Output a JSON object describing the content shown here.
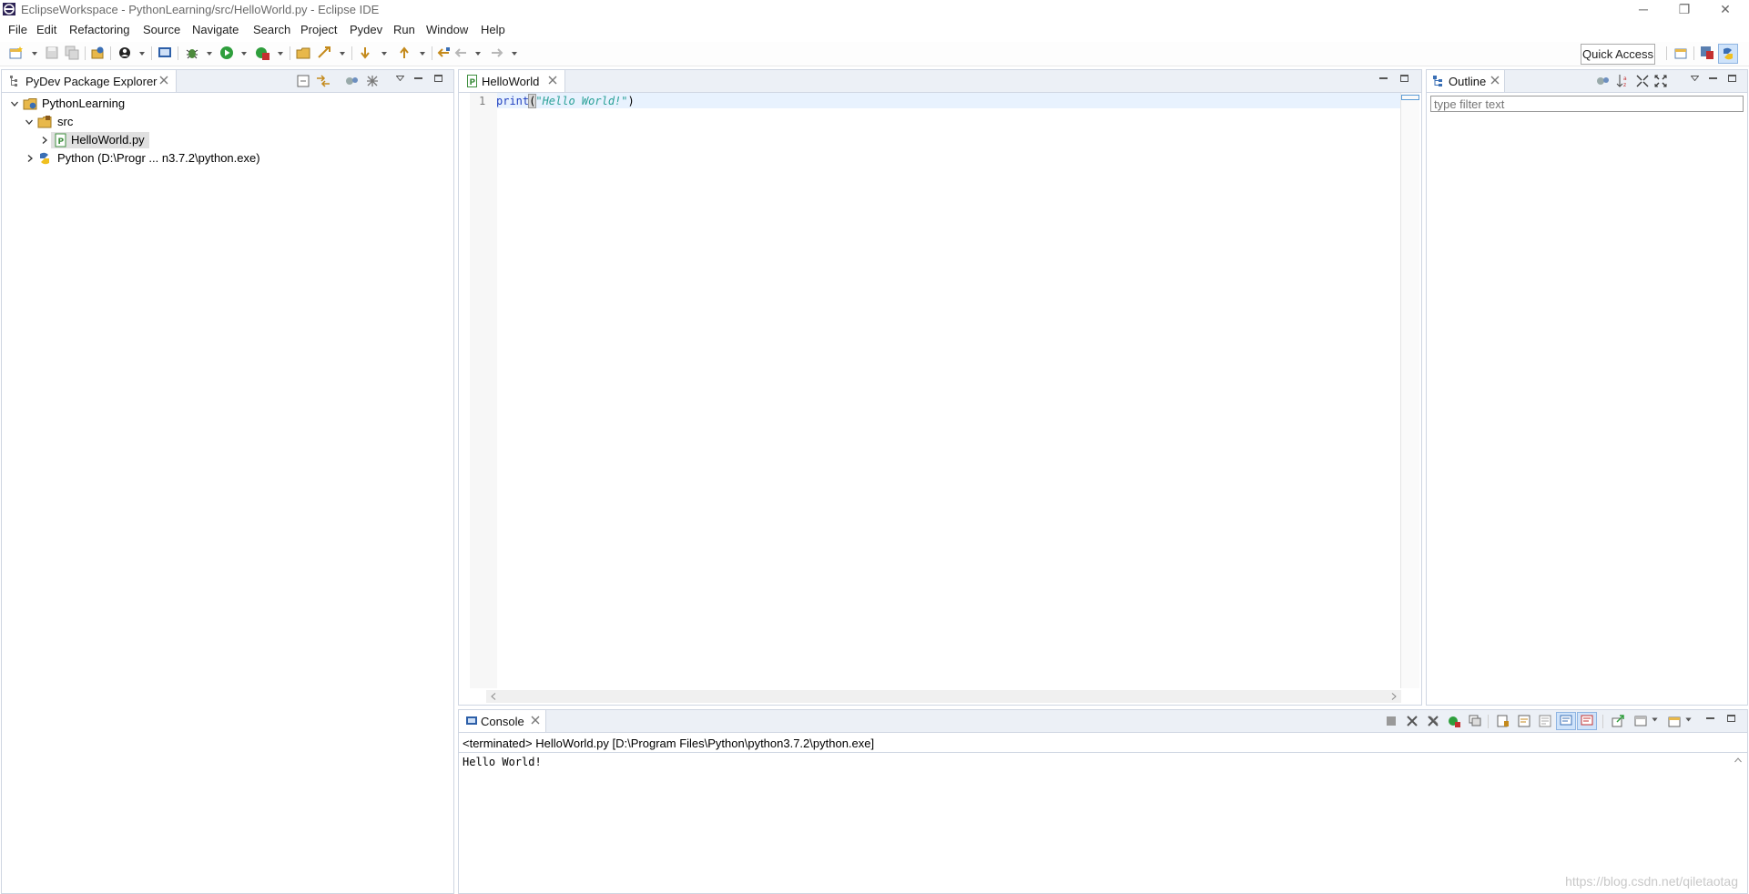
{
  "window": {
    "title": "EclipseWorkspace - PythonLearning/src/HelloWorld.py - Eclipse IDE",
    "controls": {
      "minimize": "─",
      "restore": "❐",
      "close": "✕"
    }
  },
  "menu": [
    "File",
    "Edit",
    "Refactoring",
    "Source",
    "Navigate",
    "Search",
    "Project",
    "Pydev",
    "Run",
    "Window",
    "Help"
  ],
  "toolbar": {
    "quick_access": "Quick Access",
    "icons": [
      "new-wizard-icon",
      "save-icon",
      "save-all-icon",
      "new-pydev-project-icon",
      "user-icon",
      "terminal-icon",
      "debug-icon",
      "run-icon",
      "external-tools-icon",
      "open-type-icon",
      "open-task-icon",
      "next-annotation-icon",
      "previous-annotation-icon",
      "last-edit-location-icon",
      "back-icon",
      "forward-icon"
    ]
  },
  "explorer": {
    "tab_label": "PyDev Package Explorer",
    "tree": {
      "project": "PythonLearning",
      "src": "src",
      "file": "HelloWorld.py",
      "interpreter": "Python  (D:\\Progr ... n3.7.2\\python.exe)"
    }
  },
  "editor": {
    "tab_label": "HelloWorld",
    "line_number": "1",
    "code": {
      "func": "print",
      "open_paren": "(",
      "string": "\"Hello World!\"",
      "close_paren": ")"
    }
  },
  "outline": {
    "tab_label": "Outline",
    "filter_placeholder": "type filter text"
  },
  "console": {
    "tab_label": "Console",
    "status": "<terminated> HelloWorld.py [D:\\Program Files\\Python\\python3.7.2\\python.exe]",
    "output": "Hello World!"
  },
  "watermark": "https://blog.csdn.net/qiletaotag",
  "colors": {
    "panel_border": "#cfd6e2",
    "tab_bar": "#ecf0f6",
    "keyword_blue": "#1f3fbf",
    "string_green": "#2aa198",
    "current_line": "#e8f2fe"
  }
}
